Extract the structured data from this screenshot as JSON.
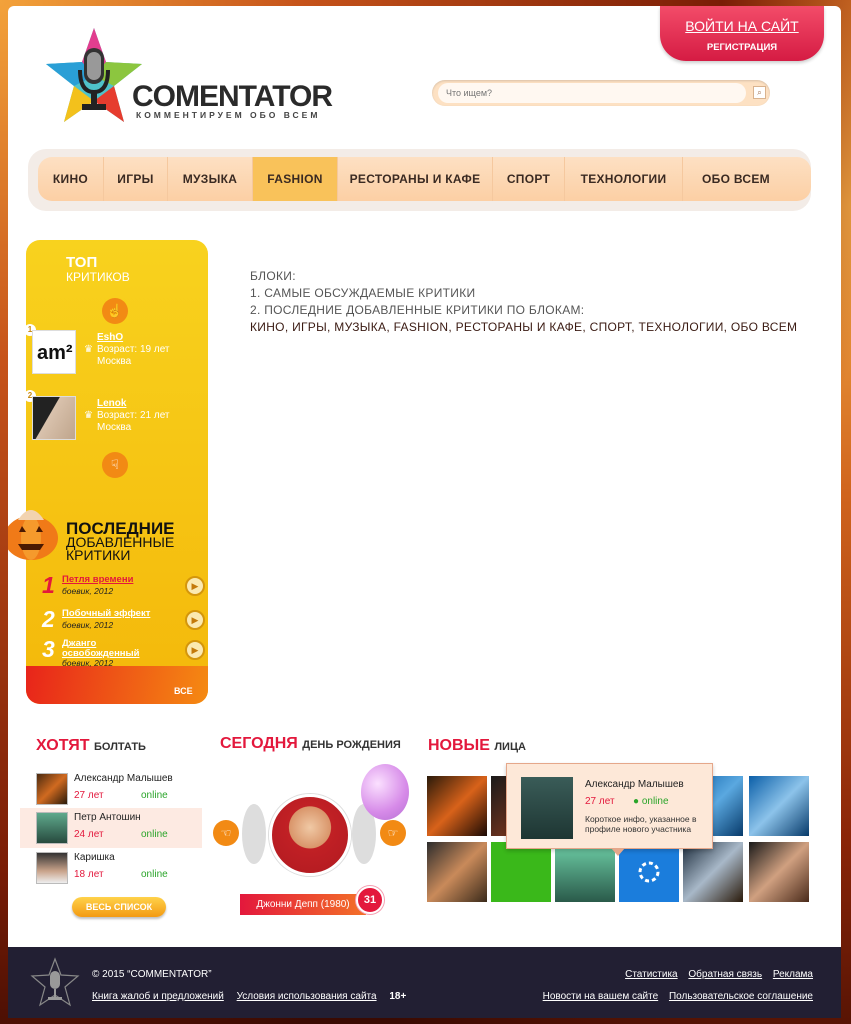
{
  "header": {
    "brand": "COMENTATOR",
    "tagline": "КОММЕНТИРУЕМ ОБО ВСЕМ",
    "login_label": "ВОЙТИ НА САЙТ",
    "register_label": "РЕГИСТРАЦИЯ",
    "search_placeholder": "Что ищем?"
  },
  "nav": [
    {
      "label": "КИНО"
    },
    {
      "label": "ИГРЫ"
    },
    {
      "label": "МУЗЫКА"
    },
    {
      "label": "FASHION",
      "active": true
    },
    {
      "label": "РЕСТОРАНЫ И КАФЕ"
    },
    {
      "label": "СПОРТ"
    },
    {
      "label": "ТЕХНОЛОГИИ"
    },
    {
      "label": "ОБО ВСЕМ"
    }
  ],
  "content": {
    "line1": "БЛОКИ:",
    "line2": "1. САМЫЕ ОБСУЖДАЕМЫЕ КРИТИКИ",
    "line3": "2. ПОСЛЕДНИЕ ДОБАВЛЕННЫЕ КРИТИКИ ПО БЛОКАМ:",
    "line4": "КИНО, ИГРЫ, МУЗЫКА, FASHION, РЕСТОРАНЫ И КАФЕ, СПОРТ, ТЕХНОЛОГИИ, ОБО ВСЕМ"
  },
  "top_critics": {
    "title_big": "ТОП",
    "title_small": "КРИТИКОВ",
    "items": [
      {
        "rank": "1",
        "name": "EshO",
        "age": "Возраст: 19 лет",
        "city": "Москва"
      },
      {
        "rank": "2",
        "name": "Lenok",
        "age": "Возраст: 21 лет",
        "city": "Москва"
      }
    ]
  },
  "latest_critics": {
    "title_big": "ПОСЛЕДНИЕ",
    "title_small1": "ДОБАВЛЕННЫЕ",
    "title_small2": "КРИТИКИ",
    "items": [
      {
        "num": "1",
        "title": "Петля времени",
        "genre": "боевик, 2012"
      },
      {
        "num": "2",
        "title": "Побочный эффект",
        "genre": "боевик, 2012"
      },
      {
        "num": "3",
        "title": "Джанго освобожденный",
        "genre": "боевик, 2012"
      }
    ],
    "all_label": "ВСЕ"
  },
  "chat": {
    "title_big": "ХОТЯТ",
    "title_small": "БОЛТАТЬ",
    "users": [
      {
        "name": "Александр Малышев",
        "age": "27 лет",
        "status": "online"
      },
      {
        "name": "Петр Антошин",
        "age": "24 лет",
        "status": "online"
      },
      {
        "name": "Каришка",
        "age": "18 лет",
        "status": "online"
      }
    ],
    "all_label": "ВЕСЬ СПИСОК"
  },
  "birthday": {
    "title_big": "СЕГОДНЯ",
    "title_small": "ДЕНЬ РОЖДЕНИЯ",
    "name": "Джонни Депп (1980)",
    "age": "31"
  },
  "new_faces": {
    "title_big": "НОВЫЕ",
    "title_small": "ЛИЦА",
    "popup": {
      "name": "Александр Малышев",
      "age": "27 лет",
      "status": "● online",
      "info": "Короткое инфо, указанное в профиле нового участника"
    }
  },
  "footer": {
    "copyright": "© 2015 “COMMENTATOR”",
    "link_complaints": "Книга жалоб и предложений",
    "link_terms": "Условия использования сайта",
    "age_limit": "18+",
    "link_stats": "Статистика",
    "link_feedback": "Обратная связь",
    "link_ads": "Реклама",
    "link_news": "Новости на вашем сайте",
    "link_agreement": "Пользовательское соглашение"
  },
  "colors": {
    "accent": "#e3183c",
    "sidebar": "#f6c514",
    "orange": "#f28a14",
    "online": "#2aa52a",
    "footer_bg": "#221f33"
  }
}
